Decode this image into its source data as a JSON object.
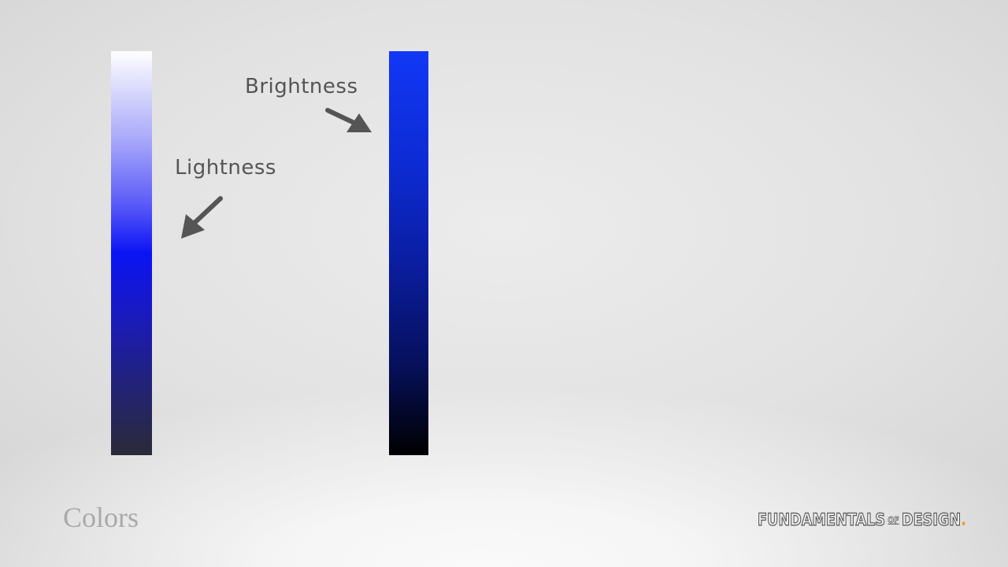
{
  "slide": {
    "title": "Colors"
  },
  "annotations": {
    "brightness_label": "Brightness",
    "lightness_label": "Lightness"
  },
  "logo": {
    "word1": "FUNDAMENTALS",
    "word2": "OF",
    "word3": "DESIGN",
    "dot": "."
  },
  "colors": {
    "base_blue": "#0a14f4",
    "lightness_top": "#ffffff",
    "lightness_bottom": "#2a2a38",
    "brightness_top": "#1238f6",
    "brightness_bottom": "#000000",
    "annotation_gray": "#555555",
    "title_gray": "#a9a9a9",
    "logo_accent": "#e6a21c"
  },
  "icons": {
    "arrow_brightness": "arrow-down-right-icon",
    "arrow_lightness": "arrow-down-left-icon"
  }
}
